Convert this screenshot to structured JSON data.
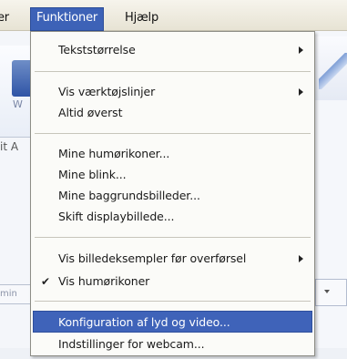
{
  "menubar": {
    "prev_item_fragment": "er",
    "active_menu": "Funktioner",
    "help_menu": "Hjælp"
  },
  "background": {
    "tool_letter": "W",
    "tab_fragment": "it A",
    "field_fragment": "min"
  },
  "menu": {
    "items": [
      {
        "label": "Tekststørrelse",
        "submenu": true
      },
      {
        "label": "Vis værktøjslinjer",
        "submenu": true
      },
      {
        "label": "Altid øverst"
      },
      {
        "label": "Mine humørikoner..."
      },
      {
        "label": "Mine blink..."
      },
      {
        "label": "Mine baggrundsbilleder..."
      },
      {
        "label": "Skift displaybillede..."
      },
      {
        "label": "Vis billedeksempler før overførsel",
        "submenu": true
      },
      {
        "label": "Vis humørikoner",
        "checked": true
      },
      {
        "label": "Konfiguration af lyd og video...",
        "highlighted": true
      },
      {
        "label": "Indstillinger for webcam..."
      }
    ],
    "check_glyph": "✔"
  },
  "colors": {
    "highlight": "#3f63b9",
    "menu_background": "#fbfbf8"
  }
}
